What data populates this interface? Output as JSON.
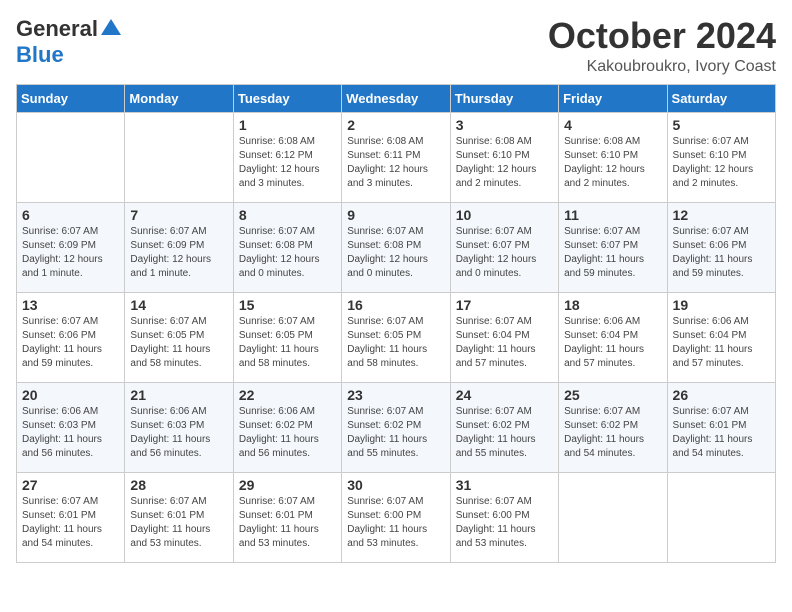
{
  "header": {
    "logo_general": "General",
    "logo_blue": "Blue",
    "month_title": "October 2024",
    "location": "Kakoubroukro, Ivory Coast"
  },
  "weekdays": [
    "Sunday",
    "Monday",
    "Tuesday",
    "Wednesday",
    "Thursday",
    "Friday",
    "Saturday"
  ],
  "weeks": [
    [
      {
        "day": "",
        "detail": ""
      },
      {
        "day": "",
        "detail": ""
      },
      {
        "day": "1",
        "detail": "Sunrise: 6:08 AM\nSunset: 6:12 PM\nDaylight: 12 hours\nand 3 minutes."
      },
      {
        "day": "2",
        "detail": "Sunrise: 6:08 AM\nSunset: 6:11 PM\nDaylight: 12 hours\nand 3 minutes."
      },
      {
        "day": "3",
        "detail": "Sunrise: 6:08 AM\nSunset: 6:10 PM\nDaylight: 12 hours\nand 2 minutes."
      },
      {
        "day": "4",
        "detail": "Sunrise: 6:08 AM\nSunset: 6:10 PM\nDaylight: 12 hours\nand 2 minutes."
      },
      {
        "day": "5",
        "detail": "Sunrise: 6:07 AM\nSunset: 6:10 PM\nDaylight: 12 hours\nand 2 minutes."
      }
    ],
    [
      {
        "day": "6",
        "detail": "Sunrise: 6:07 AM\nSunset: 6:09 PM\nDaylight: 12 hours\nand 1 minute."
      },
      {
        "day": "7",
        "detail": "Sunrise: 6:07 AM\nSunset: 6:09 PM\nDaylight: 12 hours\nand 1 minute."
      },
      {
        "day": "8",
        "detail": "Sunrise: 6:07 AM\nSunset: 6:08 PM\nDaylight: 12 hours\nand 0 minutes."
      },
      {
        "day": "9",
        "detail": "Sunrise: 6:07 AM\nSunset: 6:08 PM\nDaylight: 12 hours\nand 0 minutes."
      },
      {
        "day": "10",
        "detail": "Sunrise: 6:07 AM\nSunset: 6:07 PM\nDaylight: 12 hours\nand 0 minutes."
      },
      {
        "day": "11",
        "detail": "Sunrise: 6:07 AM\nSunset: 6:07 PM\nDaylight: 11 hours\nand 59 minutes."
      },
      {
        "day": "12",
        "detail": "Sunrise: 6:07 AM\nSunset: 6:06 PM\nDaylight: 11 hours\nand 59 minutes."
      }
    ],
    [
      {
        "day": "13",
        "detail": "Sunrise: 6:07 AM\nSunset: 6:06 PM\nDaylight: 11 hours\nand 59 minutes."
      },
      {
        "day": "14",
        "detail": "Sunrise: 6:07 AM\nSunset: 6:05 PM\nDaylight: 11 hours\nand 58 minutes."
      },
      {
        "day": "15",
        "detail": "Sunrise: 6:07 AM\nSunset: 6:05 PM\nDaylight: 11 hours\nand 58 minutes."
      },
      {
        "day": "16",
        "detail": "Sunrise: 6:07 AM\nSunset: 6:05 PM\nDaylight: 11 hours\nand 58 minutes."
      },
      {
        "day": "17",
        "detail": "Sunrise: 6:07 AM\nSunset: 6:04 PM\nDaylight: 11 hours\nand 57 minutes."
      },
      {
        "day": "18",
        "detail": "Sunrise: 6:06 AM\nSunset: 6:04 PM\nDaylight: 11 hours\nand 57 minutes."
      },
      {
        "day": "19",
        "detail": "Sunrise: 6:06 AM\nSunset: 6:04 PM\nDaylight: 11 hours\nand 57 minutes."
      }
    ],
    [
      {
        "day": "20",
        "detail": "Sunrise: 6:06 AM\nSunset: 6:03 PM\nDaylight: 11 hours\nand 56 minutes."
      },
      {
        "day": "21",
        "detail": "Sunrise: 6:06 AM\nSunset: 6:03 PM\nDaylight: 11 hours\nand 56 minutes."
      },
      {
        "day": "22",
        "detail": "Sunrise: 6:06 AM\nSunset: 6:02 PM\nDaylight: 11 hours\nand 56 minutes."
      },
      {
        "day": "23",
        "detail": "Sunrise: 6:07 AM\nSunset: 6:02 PM\nDaylight: 11 hours\nand 55 minutes."
      },
      {
        "day": "24",
        "detail": "Sunrise: 6:07 AM\nSunset: 6:02 PM\nDaylight: 11 hours\nand 55 minutes."
      },
      {
        "day": "25",
        "detail": "Sunrise: 6:07 AM\nSunset: 6:02 PM\nDaylight: 11 hours\nand 54 minutes."
      },
      {
        "day": "26",
        "detail": "Sunrise: 6:07 AM\nSunset: 6:01 PM\nDaylight: 11 hours\nand 54 minutes."
      }
    ],
    [
      {
        "day": "27",
        "detail": "Sunrise: 6:07 AM\nSunset: 6:01 PM\nDaylight: 11 hours\nand 54 minutes."
      },
      {
        "day": "28",
        "detail": "Sunrise: 6:07 AM\nSunset: 6:01 PM\nDaylight: 11 hours\nand 53 minutes."
      },
      {
        "day": "29",
        "detail": "Sunrise: 6:07 AM\nSunset: 6:01 PM\nDaylight: 11 hours\nand 53 minutes."
      },
      {
        "day": "30",
        "detail": "Sunrise: 6:07 AM\nSunset: 6:00 PM\nDaylight: 11 hours\nand 53 minutes."
      },
      {
        "day": "31",
        "detail": "Sunrise: 6:07 AM\nSunset: 6:00 PM\nDaylight: 11 hours\nand 53 minutes."
      },
      {
        "day": "",
        "detail": ""
      },
      {
        "day": "",
        "detail": ""
      }
    ]
  ]
}
